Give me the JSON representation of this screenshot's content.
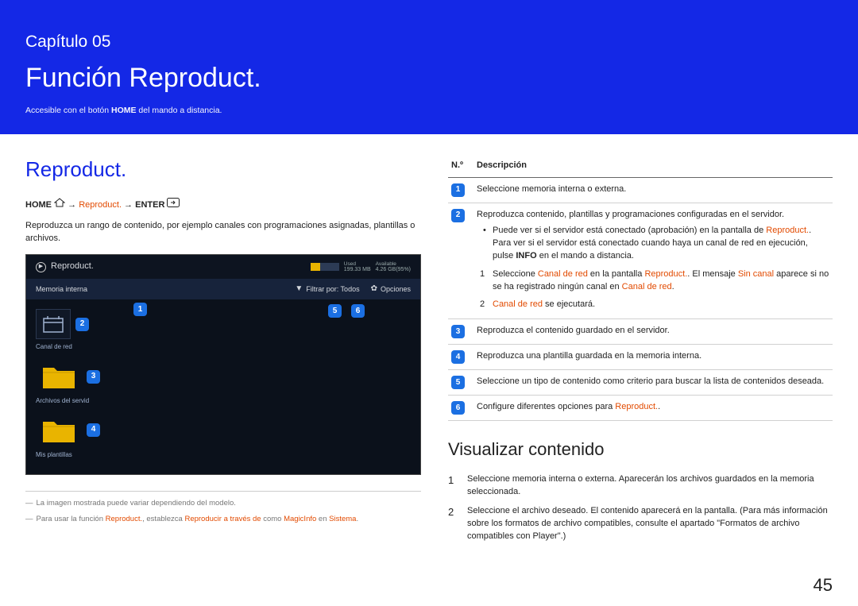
{
  "page_number": "45",
  "hero": {
    "chapter": "Capítulo 05",
    "title": "Función Reproduct.",
    "sub_pre": "Accesible con el botón ",
    "sub_bold": "HOME",
    "sub_post": " del mando a distancia."
  },
  "left": {
    "section_title": "Reproduct.",
    "breadcrumb": {
      "home": "HOME",
      "p1": "Reproduct.",
      "p2": "ENTER"
    },
    "para": "Reproduzca un rango de contenido, por ejemplo canales con programaciones asignadas, plantillas o archivos.",
    "shot": {
      "title": "Reproduct.",
      "used_lbl": "Used",
      "used_val": "199.33 MB",
      "avail_lbl": "Available",
      "avail_val": "4.26 GB(95%)",
      "row_mem": "Memoria interna",
      "filter": "Filtrar por: Todos",
      "options": "Opciones",
      "item2": "Canal de red",
      "item3": "Archivos del servid",
      "item4": "Mis plantillas",
      "m1": "1",
      "m2": "2",
      "m3": "3",
      "m4": "4",
      "m5": "5",
      "m6": "6"
    },
    "fn1": "La imagen mostrada puede variar dependiendo del modelo.",
    "fn2_pre": "Para usar la función ",
    "fn2_r1": "Reproduct.",
    "fn2_mid": ", establezca ",
    "fn2_r2": "Reproducir a través de",
    "fn2_mid2": " como ",
    "fn2_r3": "MagicInfo",
    "fn2_mid3": " en ",
    "fn2_r4": "Sistema",
    "fn2_end": "."
  },
  "right": {
    "th_no": "N.º",
    "th_desc": "Descripción",
    "rows": {
      "r1": {
        "m": "1",
        "text": "Seleccione memoria interna o externa."
      },
      "r2": {
        "m": "2",
        "text": "Reproduzca contenido, plantillas y programaciones configuradas en el servidor.",
        "b1_pre": "Puede ver si el servidor está conectado (aprobación) en la pantalla de ",
        "b1_r": "Reproduct.",
        "b1_post": ". Para ver si el servidor está conectado cuando haya un canal de red en ejecución, pulse ",
        "b1_bold": "INFO",
        "b1_end": " en el mando a distancia.",
        "s1_n": "1",
        "s1_pre": "Seleccione ",
        "s1_r1": "Canal de red",
        "s1_mid": " en la pantalla ",
        "s1_r2": "Reproduct.",
        "s1_mid2": ". El mensaje  ",
        "s1_r3": "Sin canal",
        "s1_post": " aparece si no se ha registrado ningún canal en ",
        "s1_r4": "Canal de red",
        "s1_end": ".",
        "s2_n": "2",
        "s2_r": "Canal de red",
        "s2_post": " se ejecutará."
      },
      "r3": {
        "m": "3",
        "text": "Reproduzca el contenido guardado en el servidor."
      },
      "r4": {
        "m": "4",
        "text": "Reproduzca una plantilla guardada en la memoria interna."
      },
      "r5": {
        "m": "5",
        "text": "Seleccione un tipo de contenido como criterio para buscar la lista de contenidos deseada."
      },
      "r6": {
        "m": "6",
        "text_pre": "Configure diferentes opciones para ",
        "text_r": "Reproduct.",
        "text_end": "."
      }
    },
    "h2": "Visualizar contenido",
    "list": {
      "n1": "1",
      "t1": "Seleccione memoria interna o externa. Aparecerán los archivos guardados en la memoria seleccionada.",
      "n2": "2",
      "t2": "Seleccione el archivo deseado. El contenido aparecerá en la pantalla. (Para más información sobre los formatos de archivo compatibles, consulte el apartado \"Formatos de archivo compatibles con Player\".)"
    }
  }
}
